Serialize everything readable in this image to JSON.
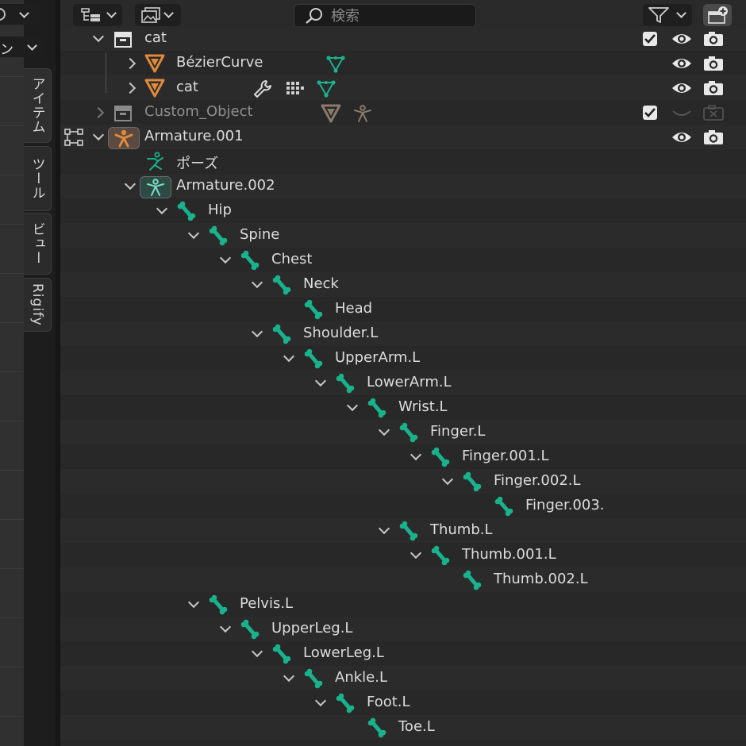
{
  "left_panel": {
    "mode_dropdown_text": "ン",
    "tabs": [
      {
        "label": "アイテム"
      },
      {
        "label": "ツール"
      },
      {
        "label": "ビュー"
      },
      {
        "label": "Rigify"
      }
    ]
  },
  "header": {
    "search_placeholder": "検索"
  },
  "tree": [
    {
      "label": "cat",
      "depth": 0,
      "expander": "open",
      "icon": "collection-icon",
      "checkbox": true,
      "eye": true,
      "camera": true
    },
    {
      "label": "BézierCurve",
      "depth": 1,
      "expander": "closed",
      "icon": "object-icon",
      "extras": [
        "mesh-data-icon"
      ],
      "eye": true,
      "camera": true
    },
    {
      "label": "cat",
      "depth": 1,
      "expander": "closed",
      "icon": "object-icon",
      "extras": [
        "wrench-icon",
        "vertex-groups-icon",
        "mesh-data-icon"
      ],
      "eye": true,
      "camera": true
    },
    {
      "label": "Custom_Object",
      "depth": 0,
      "expander": "closed",
      "icon": "collection-icon",
      "dim": true,
      "extras": [
        "object-icon",
        "armature-data-icon"
      ],
      "checkbox": true,
      "eye_closed": true,
      "camera_disabled": true
    },
    {
      "label": "Armature.001",
      "depth": 0,
      "expander": "open",
      "icon": "armature-object-icon",
      "highlight": true,
      "eye": true,
      "camera": true
    },
    {
      "label": "ポーズ",
      "depth": 1,
      "icon": "pose-icon"
    },
    {
      "label": "Armature.002",
      "depth": 1,
      "expander": "open",
      "icon": "armature-data-icon",
      "highlight": true
    },
    {
      "label": "Hip",
      "depth": 2,
      "expander": "open",
      "icon": "bone-icon"
    },
    {
      "label": "Spine",
      "depth": 3,
      "expander": "open",
      "icon": "bone-icon"
    },
    {
      "label": "Chest",
      "depth": 4,
      "expander": "open",
      "icon": "bone-icon"
    },
    {
      "label": "Neck",
      "depth": 5,
      "expander": "open",
      "icon": "bone-icon"
    },
    {
      "label": "Head",
      "depth": 6,
      "icon": "bone-icon"
    },
    {
      "label": "Shoulder.L",
      "depth": 5,
      "expander": "open",
      "icon": "bone-icon"
    },
    {
      "label": "UpperArm.L",
      "depth": 6,
      "expander": "open",
      "icon": "bone-icon"
    },
    {
      "label": "LowerArm.L",
      "depth": 7,
      "expander": "open",
      "icon": "bone-icon"
    },
    {
      "label": "Wrist.L",
      "depth": 8,
      "expander": "open",
      "icon": "bone-icon"
    },
    {
      "label": "Finger.L",
      "depth": 9,
      "expander": "open",
      "icon": "bone-icon"
    },
    {
      "label": "Finger.001.L",
      "depth": 10,
      "expander": "open",
      "icon": "bone-icon"
    },
    {
      "label": "Finger.002.L",
      "depth": 11,
      "expander": "open",
      "icon": "bone-icon"
    },
    {
      "label": "Finger.003.",
      "depth": 12,
      "icon": "bone-icon"
    },
    {
      "label": "Thumb.L",
      "depth": 9,
      "expander": "open",
      "icon": "bone-icon"
    },
    {
      "label": "Thumb.001.L",
      "depth": 10,
      "expander": "open",
      "icon": "bone-icon"
    },
    {
      "label": "Thumb.002.L",
      "depth": 11,
      "icon": "bone-icon"
    },
    {
      "label": "Pelvis.L",
      "depth": 3,
      "expander": "open",
      "icon": "bone-icon"
    },
    {
      "label": "UpperLeg.L",
      "depth": 4,
      "expander": "open",
      "icon": "bone-icon"
    },
    {
      "label": "LowerLeg.L",
      "depth": 5,
      "expander": "open",
      "icon": "bone-icon"
    },
    {
      "label": "Ankle.L",
      "depth": 6,
      "expander": "open",
      "icon": "bone-icon"
    },
    {
      "label": "Foot.L",
      "depth": 7,
      "expander": "open",
      "icon": "bone-icon"
    },
    {
      "label": "Toe.L",
      "depth": 8,
      "icon": "bone-icon"
    }
  ],
  "colors": {
    "bone": "#19b28d",
    "object": "#e08a3c",
    "mesh": "#19b28d"
  }
}
